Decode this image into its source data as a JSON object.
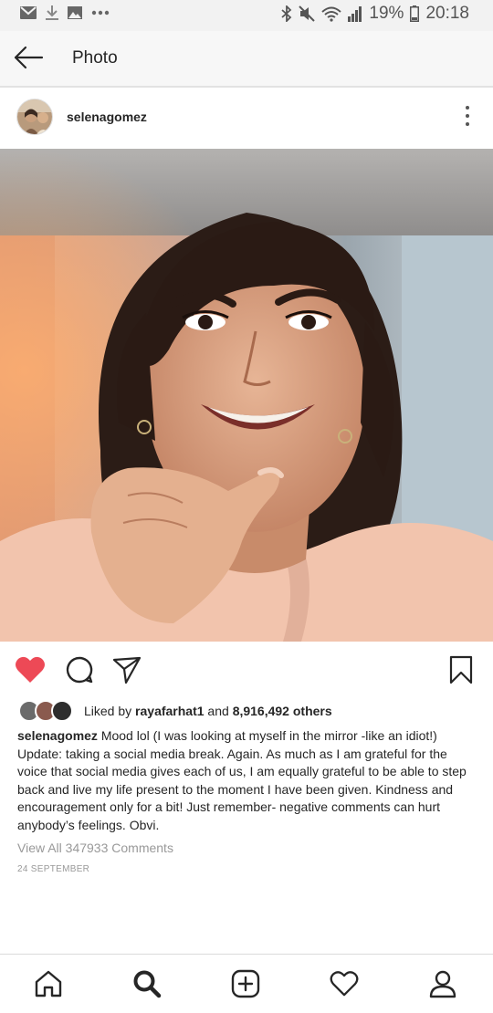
{
  "status_bar": {
    "battery": "19%",
    "time": "20:18",
    "icons": [
      "mail-icon",
      "download-icon",
      "image-icon",
      "more-dots-icon",
      "bluetooth-icon",
      "mute-icon",
      "wifi-icon",
      "signal-icon",
      "battery-icon"
    ]
  },
  "header": {
    "title": "Photo",
    "back_icon": "back-arrow-icon"
  },
  "post": {
    "username": "selenagomez",
    "likes": {
      "prefix": "Liked by ",
      "user": "rayafarhat1",
      "middle": " and ",
      "others": "8,916,492 others"
    },
    "caption_user": "selenagomez",
    "caption_text": " Mood lol (I was looking at myself in the mirror -like an idiot!) Update: taking a social media break. Again. As much as I am grateful for the voice that social media gives each of us, I am equally grateful to be able to step back and live my life present to the moment I have been given. Kindness and encouragement only for a bit! Just remember- negative comments can hurt anybody’s feelings. Obvi.",
    "view_comments": "View All 347933 Comments",
    "date": "24 SEPTEMBER",
    "liked": true
  },
  "colors": {
    "like_red": "#ed4956",
    "text": "#262626",
    "muted": "#999999"
  },
  "bottom_nav": [
    "home-icon",
    "search-icon",
    "new-post-icon",
    "activity-heart-icon",
    "profile-icon"
  ]
}
